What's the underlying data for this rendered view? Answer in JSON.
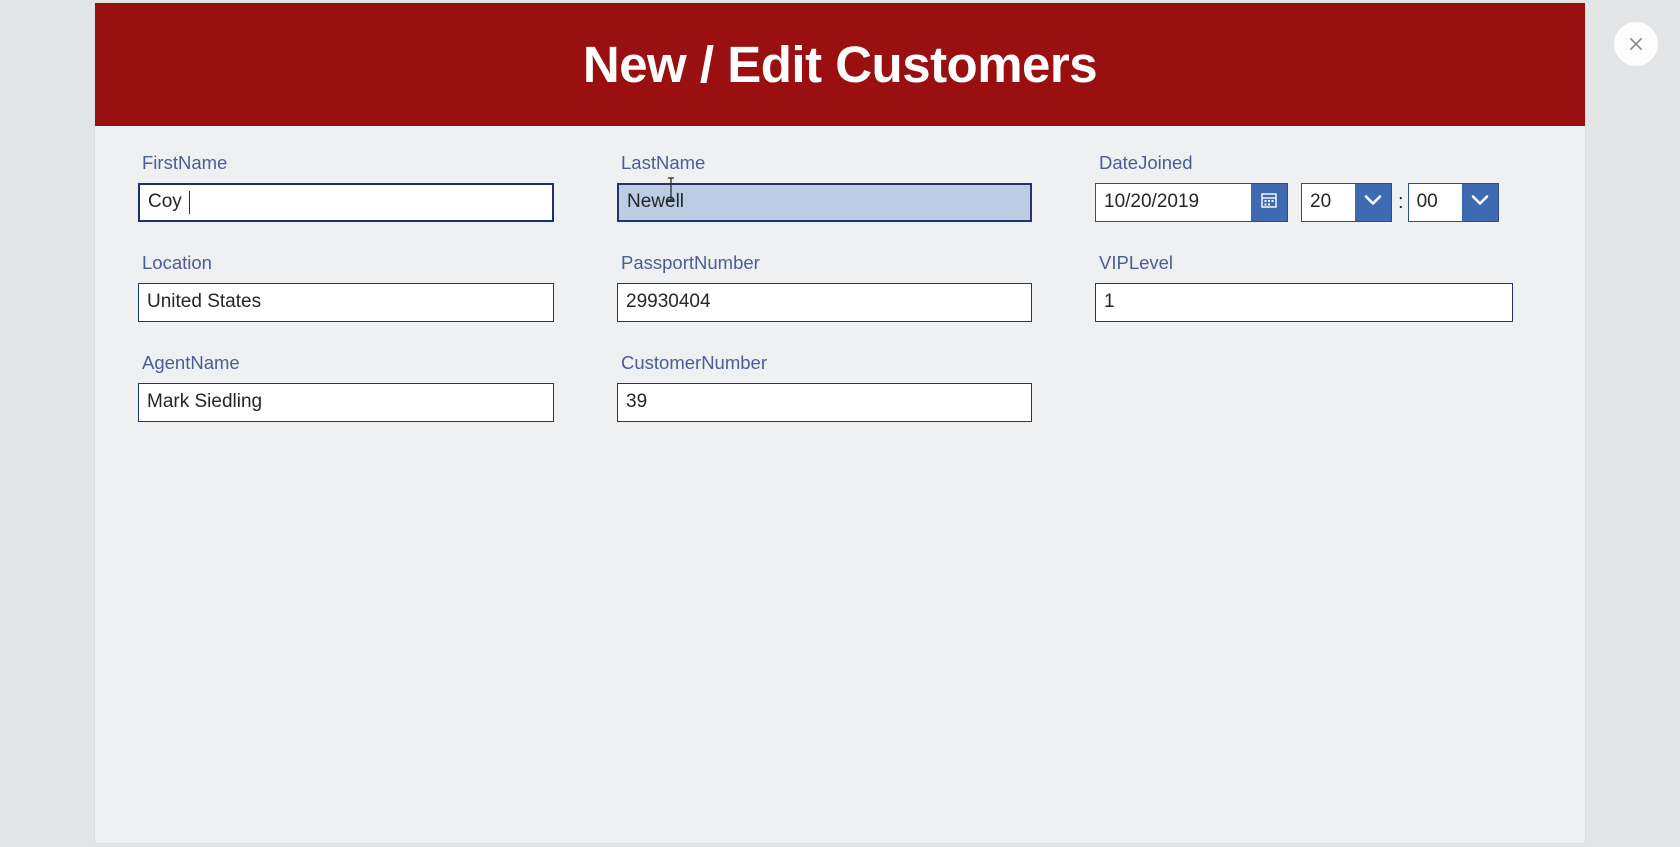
{
  "dialog": {
    "title": "New / Edit Customers",
    "close_label": "×",
    "close_icon": "close-icon",
    "header_color": "#9a1010",
    "body_color": "#eff0f2",
    "page_background": "#e3e4e6",
    "accent_color": "#1f3473",
    "button_color": "#3e6ab2",
    "label_color": "#4a5d96",
    "hover_field_color": "#bcccE4"
  },
  "fields": {
    "first_name": {
      "label": "FirstName",
      "value": "Coy",
      "state": "focused"
    },
    "last_name": {
      "label": "LastName",
      "value": "Newell",
      "state": "hovered"
    },
    "date_joined": {
      "label": "DateJoined",
      "date_value": "10/20/2019",
      "calendar_icon": "calendar-icon",
      "hours_value": "20",
      "separator": ":",
      "minutes_value": "00",
      "dropdown_icon": "chevron-down-icon"
    },
    "location": {
      "label": "Location",
      "value": "United States",
      "state": "normal"
    },
    "passport_number": {
      "label": "PassportNumber",
      "value": "29930404",
      "state": "normal"
    },
    "vip_level": {
      "label": "VIPLevel",
      "value": "1",
      "state": "normal"
    },
    "agent_name": {
      "label": "AgentName",
      "value": "Mark Siedling",
      "state": "normal"
    },
    "customer_number": {
      "label": "CustomerNumber",
      "value": "39",
      "state": "normal"
    }
  }
}
